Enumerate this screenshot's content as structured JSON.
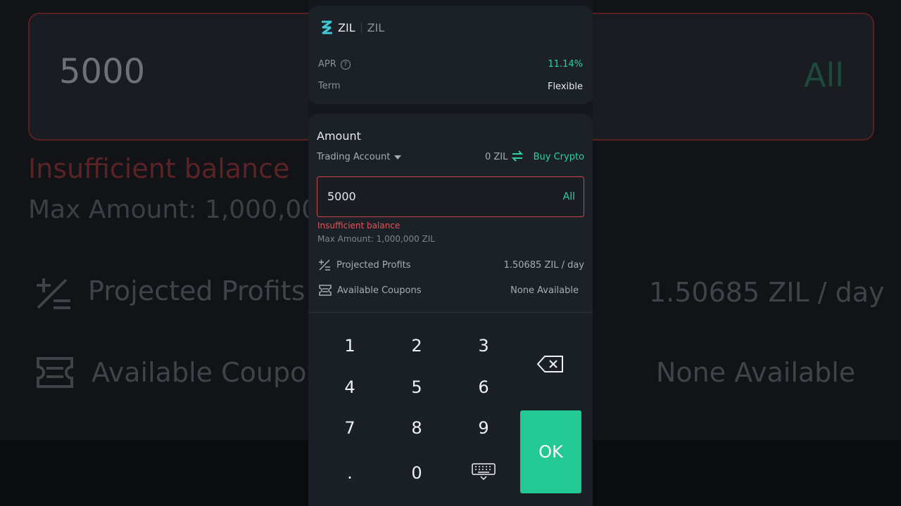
{
  "coin": {
    "symbol": "ZIL",
    "name": "ZIL"
  },
  "apr": {
    "label": "APR",
    "help_icon": "help-circle-icon",
    "value": "11.14%"
  },
  "term": {
    "label": "Term",
    "value": "Flexible"
  },
  "amount": {
    "title": "Amount",
    "account_label": "Trading Account",
    "balance": "0 ZIL",
    "buy_label": "Buy Crypto",
    "input_value": "5000",
    "all_label": "All",
    "error": "Insufficient balance",
    "max_amount": "Max Amount: 1,000,000 ZIL"
  },
  "projected": {
    "label": "Projected Profits",
    "value": "1.50685 ZIL / day"
  },
  "coupons": {
    "label": "Available Coupons",
    "value": "None Available"
  },
  "keypad": {
    "keys": [
      "1",
      "2",
      "3",
      "4",
      "5",
      "6",
      "7",
      "8",
      "9",
      ".",
      "0"
    ],
    "ok_label": "OK"
  },
  "background": {
    "amount": "5000",
    "all": "All",
    "error": "Insufficient balance",
    "max": "Max Amount: 1,000,00",
    "projected": "Projected Profits",
    "projected_value": "1.50685 ZIL / day",
    "coupons": "Available Coupo",
    "coupons_value": "None Available"
  },
  "colors": {
    "accent": "#22c993",
    "error": "#e0565c",
    "bg": "#15181c",
    "card": "#1c2128"
  }
}
